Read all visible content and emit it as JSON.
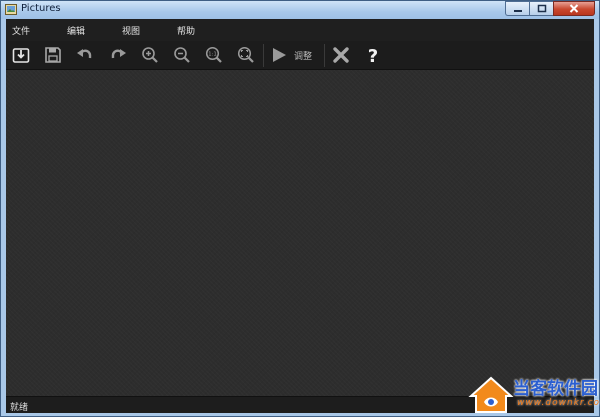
{
  "window": {
    "title": "Pictures"
  },
  "menu": {
    "items": [
      {
        "label": "文件"
      },
      {
        "label": "编辑"
      },
      {
        "label": "视图"
      },
      {
        "label": "帮助"
      }
    ]
  },
  "toolbar": {
    "buttons": [
      {
        "icon": "import-icon"
      },
      {
        "icon": "save-icon"
      },
      {
        "icon": "undo-icon"
      },
      {
        "icon": "redo-icon"
      },
      {
        "icon": "zoom-in-icon"
      },
      {
        "icon": "zoom-out-icon"
      },
      {
        "icon": "actual-size-icon",
        "text": "1:1"
      },
      {
        "icon": "fit-window-icon"
      },
      {
        "icon": "play-icon"
      },
      {
        "icon": "close-icon"
      },
      {
        "icon": "help-icon",
        "text": "?"
      }
    ],
    "adjust_label": "调整"
  },
  "status": {
    "text": "就绪"
  },
  "watermark": {
    "title": "当客软件园",
    "url": "www.downkr.com"
  },
  "colors": {
    "background": "#2d2d2d",
    "toolbar": "#1c1c1c",
    "icon": "#cfcfcf",
    "watermark_blue": "#2b5fd0",
    "watermark_orange": "#f07a1a"
  }
}
